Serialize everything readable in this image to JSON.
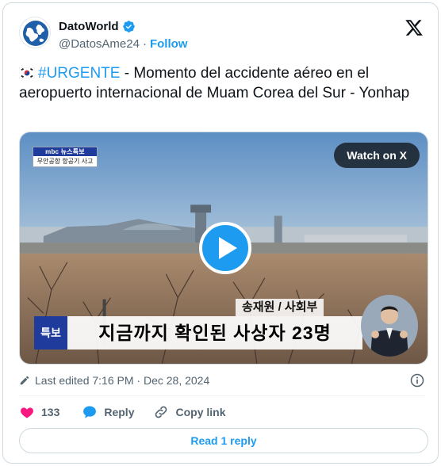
{
  "author": {
    "display_name": "DatoWorld",
    "handle": "@DatosAme24",
    "separator": "·",
    "follow_label": "Follow",
    "verified": true
  },
  "tweet": {
    "hashtag": "#URGENTE",
    "text": " - Momento del accidente aéreo en el aeropuerto internacional de Muam Corea del Sur - Yonhap"
  },
  "media": {
    "watch_label": "Watch on X",
    "badge_top": "mbc 뉴스특보",
    "badge_bottom": "무안공항 항공기 사고",
    "reporter": "송재원 / 사회부",
    "breaking_label": "특보",
    "headline": "지금까지 확인된 사상자 23명"
  },
  "meta": {
    "last_edited": "Last edited 7:16 PM · Dec 28, 2024"
  },
  "actions": {
    "like_count": "133",
    "reply_label": "Reply",
    "copy_link_label": "Copy link"
  },
  "read_replies_label": "Read 1 reply",
  "colors": {
    "accent": "#1d9bf0",
    "like": "#f91880",
    "muted": "#536471"
  }
}
